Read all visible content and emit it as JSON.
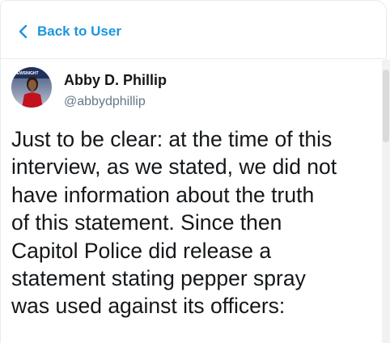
{
  "nav": {
    "back_label": "Back to User",
    "back_icon": "chevron-left-icon"
  },
  "author": {
    "name": "Abby D. Phillip",
    "handle": "@abbydphillip",
    "avatar_icon": "avatar-photo",
    "avatar_overlay_text": "NEWSNIGHT"
  },
  "tweet": {
    "text": "Just to be clear: at the time of this\ninterview, as we stated, we did not\nhave information about the truth\nof this statement.  Since then\nCapitol Police did release a\nstatement stating pepper spray\nwas used against its officers:"
  },
  "colors": {
    "accent": "#1b95e0",
    "text_primary": "#14171a",
    "text_secondary": "#657786",
    "border": "#e6ecf0"
  }
}
